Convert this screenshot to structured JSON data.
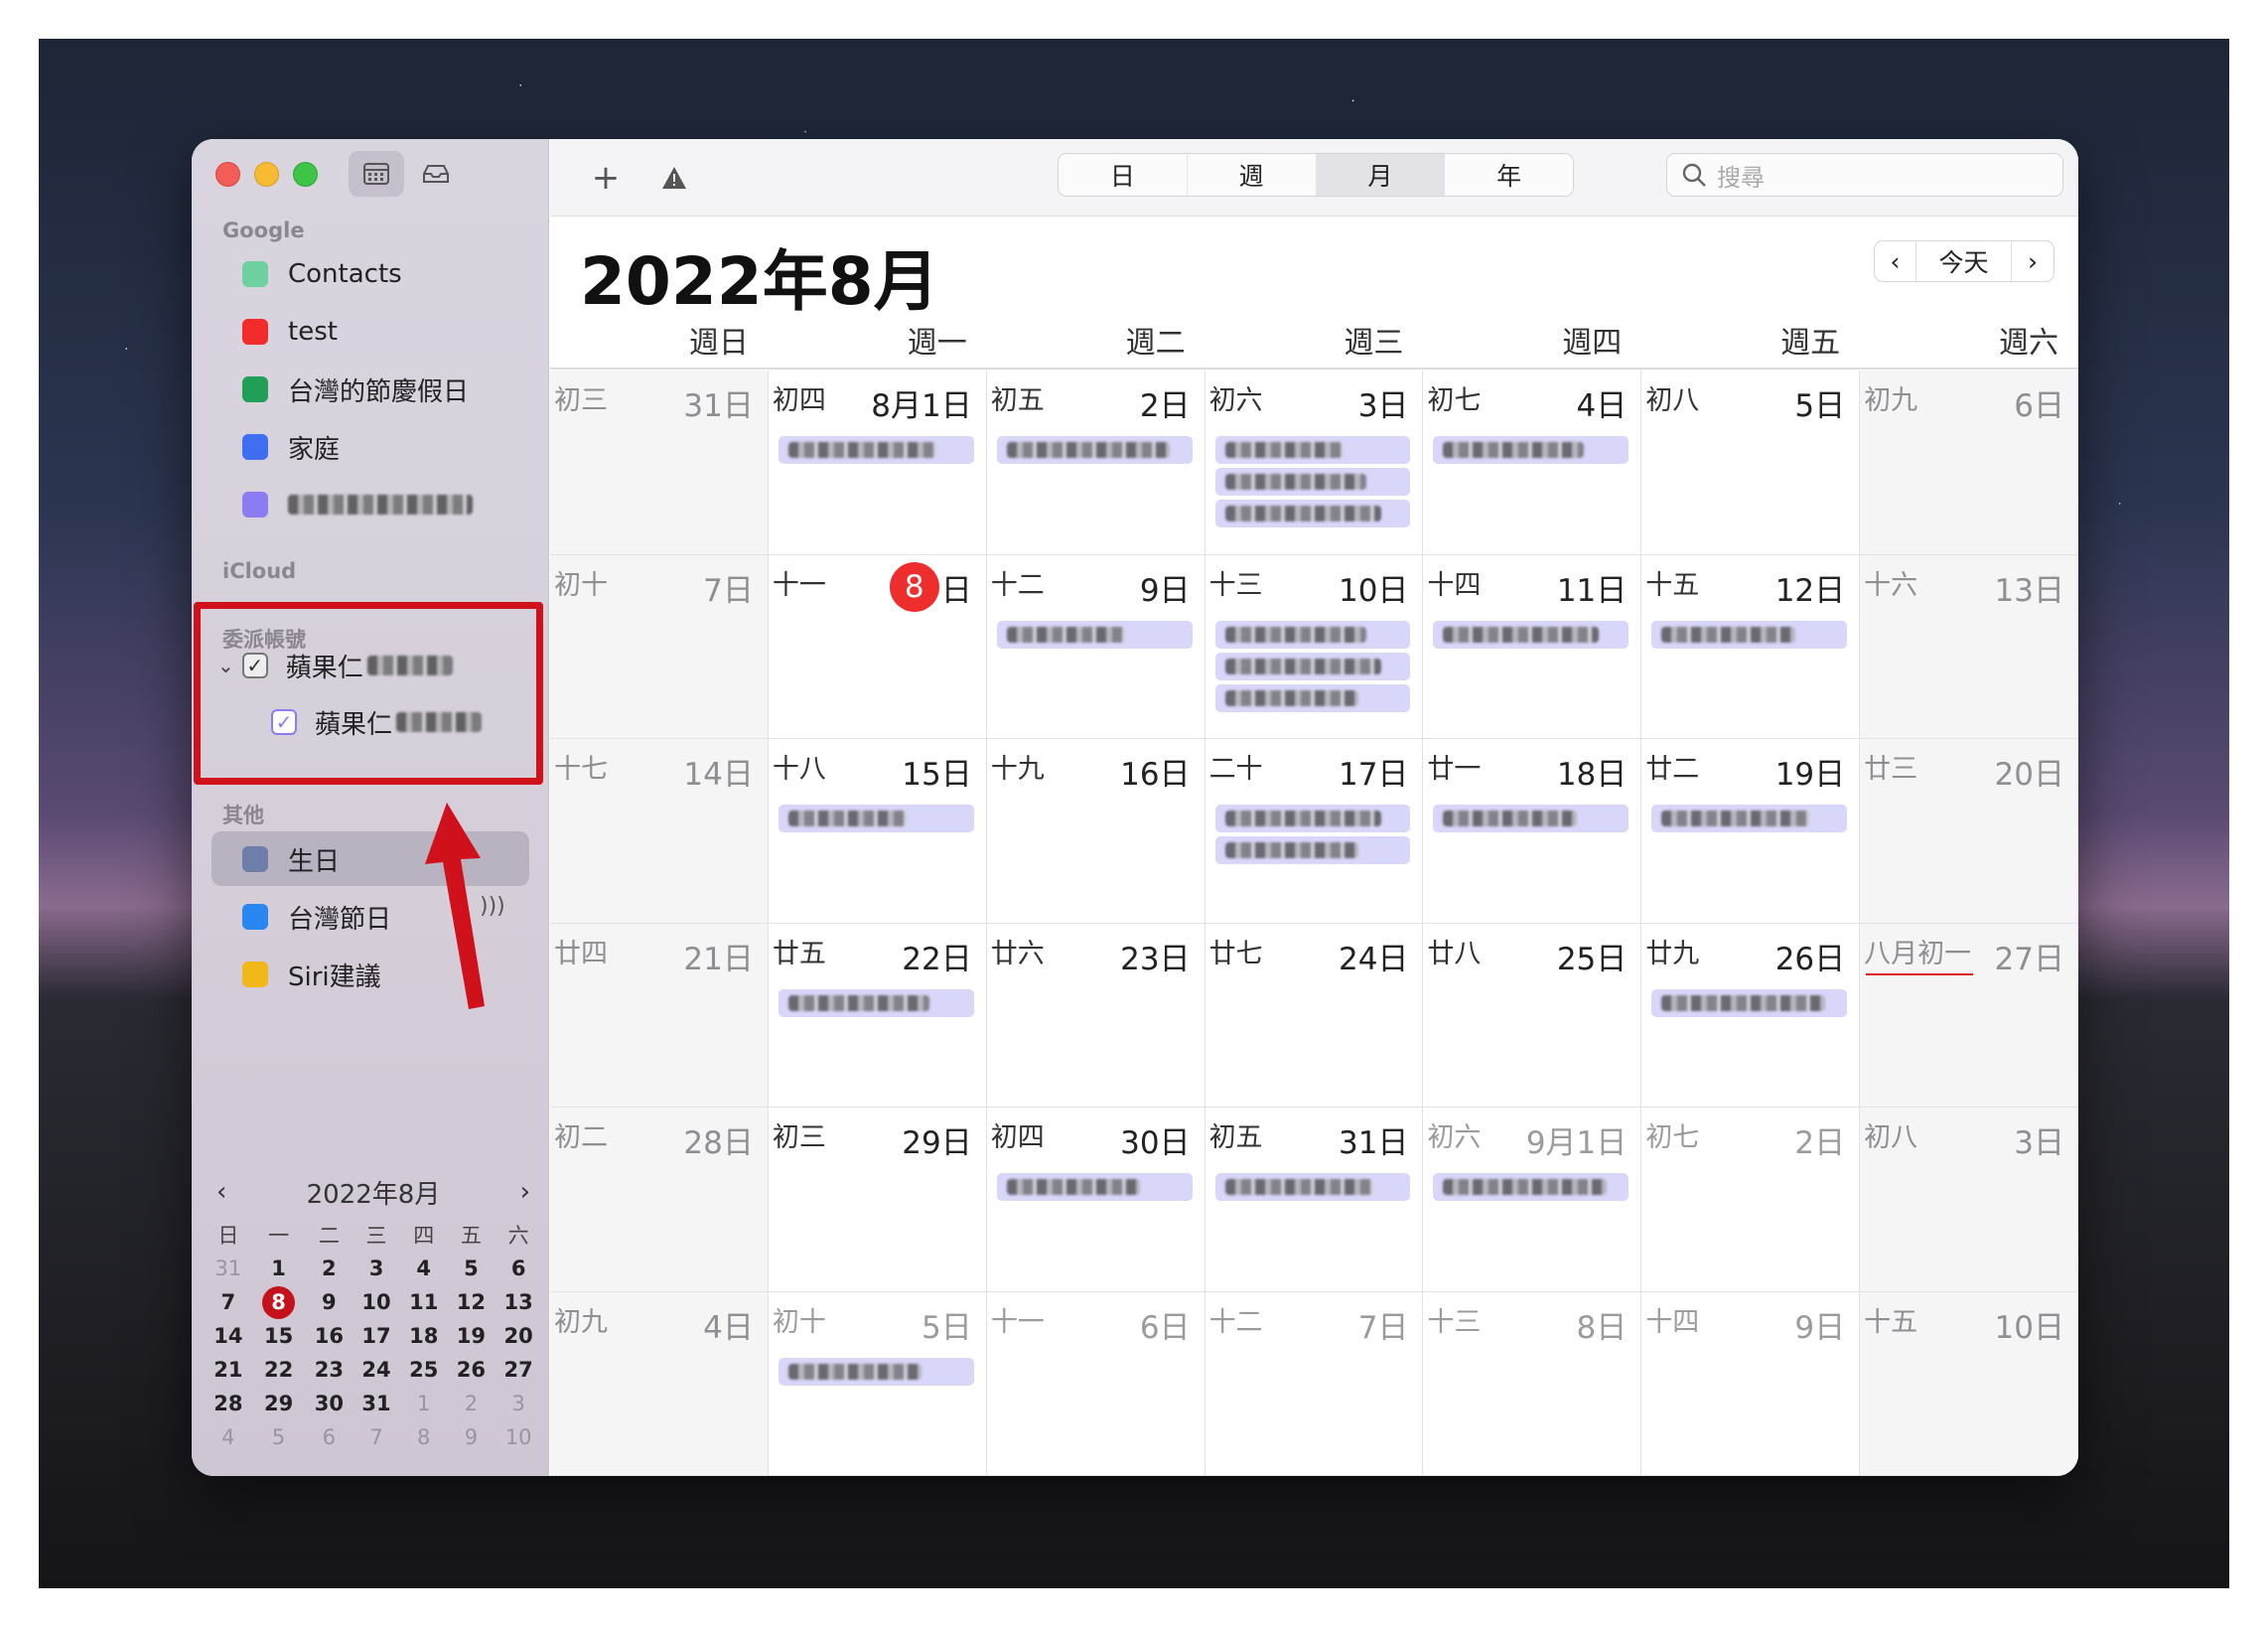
{
  "sidebar": {
    "google_label": "Google",
    "icloud_label": "iCloud",
    "delegate_label": "委派帳號",
    "other_label": "其他",
    "google_calendars": [
      {
        "label": "Contacts",
        "color": "#6fd0a2"
      },
      {
        "label": "test",
        "color": "#f22b2b"
      },
      {
        "label": "台灣的節慶假日",
        "color": "#1fa056"
      },
      {
        "label": "家庭",
        "color": "#3f6ff0"
      },
      {
        "label": "",
        "color": "#8c7cf2"
      }
    ],
    "delegate_calendars": [
      {
        "label": "蘋果仁",
        "checked": true
      },
      {
        "label": "蘋果仁",
        "checked": true,
        "color": "#8c7cf2"
      }
    ],
    "other_calendars": [
      {
        "label": "生日",
        "color": "#6e7ea8"
      },
      {
        "label": "台灣節日",
        "color": "#2a86f0"
      },
      {
        "label": "Siri建議",
        "color": "#f2b81a"
      }
    ],
    "mini_calendar": {
      "title": "2022年8月",
      "weekdays": [
        "日",
        "一",
        "二",
        "三",
        "四",
        "五",
        "六"
      ],
      "weeks": [
        [
          "31",
          "1",
          "2",
          "3",
          "4",
          "5",
          "6"
        ],
        [
          "7",
          "8",
          "9",
          "10",
          "11",
          "12",
          "13"
        ],
        [
          "14",
          "15",
          "16",
          "17",
          "18",
          "19",
          "20"
        ],
        [
          "21",
          "22",
          "23",
          "24",
          "25",
          "26",
          "27"
        ],
        [
          "28",
          "29",
          "30",
          "31",
          "1",
          "2",
          "3"
        ],
        [
          "4",
          "5",
          "6",
          "7",
          "8",
          "9",
          "10"
        ]
      ],
      "today": "8"
    }
  },
  "toolbar": {
    "add_label": "+",
    "views": [
      "日",
      "週",
      "月",
      "年"
    ],
    "active_view": "月",
    "search_placeholder": "搜尋",
    "today_label": "今天"
  },
  "calendar": {
    "title": "2022年8月",
    "weekdays": [
      "週日",
      "週一",
      "週二",
      "週三",
      "週四",
      "週五",
      "週六"
    ],
    "weeks": [
      [
        {
          "lunar": "初三",
          "day": "31日",
          "out": true,
          "events": 0
        },
        {
          "lunar": "初四",
          "day": "8月1日",
          "events": 1
        },
        {
          "lunar": "初五",
          "day": "2日",
          "events": 1
        },
        {
          "lunar": "初六",
          "day": "3日",
          "events": 3
        },
        {
          "lunar": "初七",
          "day": "4日",
          "events": 1
        },
        {
          "lunar": "初八",
          "day": "5日",
          "events": 0
        },
        {
          "lunar": "初九",
          "day": "6日",
          "events": 0
        }
      ],
      [
        {
          "lunar": "初十",
          "day": "7日",
          "events": 0
        },
        {
          "lunar": "十一",
          "day": "日",
          "today": "8",
          "events": 0
        },
        {
          "lunar": "十二",
          "day": "9日",
          "events": 1
        },
        {
          "lunar": "十三",
          "day": "10日",
          "events": 3
        },
        {
          "lunar": "十四",
          "day": "11日",
          "events": 1
        },
        {
          "lunar": "十五",
          "day": "12日",
          "events": 1
        },
        {
          "lunar": "十六",
          "day": "13日",
          "events": 0
        }
      ],
      [
        {
          "lunar": "十七",
          "day": "14日",
          "events": 0
        },
        {
          "lunar": "十八",
          "day": "15日",
          "events": 1
        },
        {
          "lunar": "十九",
          "day": "16日",
          "events": 0
        },
        {
          "lunar": "二十",
          "day": "17日",
          "events": 2
        },
        {
          "lunar": "廿一",
          "day": "18日",
          "events": 1
        },
        {
          "lunar": "廿二",
          "day": "19日",
          "events": 1
        },
        {
          "lunar": "廿三",
          "day": "20日",
          "events": 0
        }
      ],
      [
        {
          "lunar": "廿四",
          "day": "21日",
          "events": 0
        },
        {
          "lunar": "廿五",
          "day": "22日",
          "events": 1
        },
        {
          "lunar": "廿六",
          "day": "23日",
          "events": 0
        },
        {
          "lunar": "廿七",
          "day": "24日",
          "events": 0
        },
        {
          "lunar": "廿八",
          "day": "25日",
          "events": 0
        },
        {
          "lunar": "廿九",
          "day": "26日",
          "events": 1
        },
        {
          "lunar": "八月初一",
          "day": "27日",
          "events": 0,
          "underline": true
        }
      ],
      [
        {
          "lunar": "初二",
          "day": "28日",
          "events": 0
        },
        {
          "lunar": "初三",
          "day": "29日",
          "events": 0
        },
        {
          "lunar": "初四",
          "day": "30日",
          "events": 1
        },
        {
          "lunar": "初五",
          "day": "31日",
          "events": 1
        },
        {
          "lunar": "初六",
          "day": "9月1日",
          "out": true,
          "events": 1
        },
        {
          "lunar": "初七",
          "day": "2日",
          "out": true,
          "events": 0
        },
        {
          "lunar": "初八",
          "day": "3日",
          "out": true,
          "events": 0
        }
      ],
      [
        {
          "lunar": "初九",
          "day": "4日",
          "out": true,
          "events": 0
        },
        {
          "lunar": "初十",
          "day": "5日",
          "out": true,
          "events": 1
        },
        {
          "lunar": "十一",
          "day": "6日",
          "out": true,
          "events": 0
        },
        {
          "lunar": "十二",
          "day": "7日",
          "out": true,
          "events": 0
        },
        {
          "lunar": "十三",
          "day": "8日",
          "out": true,
          "events": 0
        },
        {
          "lunar": "十四",
          "day": "9日",
          "out": true,
          "events": 0
        },
        {
          "lunar": "十五",
          "day": "10日",
          "out": true,
          "events": 0
        }
      ]
    ]
  }
}
